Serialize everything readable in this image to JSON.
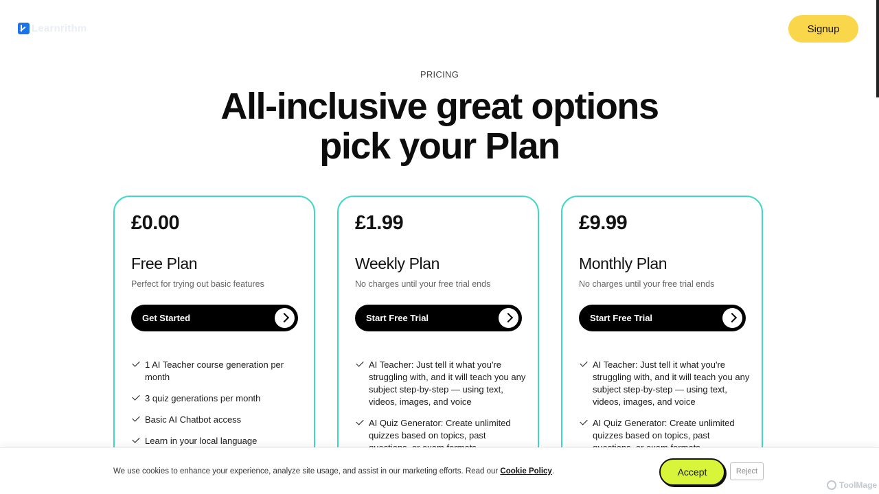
{
  "header": {
    "logo_text": "Learnrithm",
    "signup_label": "Signup"
  },
  "hero": {
    "eyebrow": "PRICING",
    "title_line1": "All-inclusive great options",
    "title_line2": "pick your Plan"
  },
  "plans": [
    {
      "price": "£0.00",
      "name": "Free Plan",
      "description": "Perfect for trying out basic features",
      "cta": "Get Started",
      "features": [
        "1 AI Teacher course generation per month",
        "3 quiz generations per month",
        "Basic AI Chatbot access",
        "Learn in your local language"
      ]
    },
    {
      "price": "£1.99",
      "name": "Weekly Plan",
      "description": "No charges until your free trial ends",
      "cta": "Start Free Trial",
      "features": [
        "AI Teacher: Just tell it what you're struggling with, and it will teach you any subject step-by-step — using text, videos, images, and voice",
        "AI Quiz Generator: Create unlimited quizzes based on topics, past questions, or exam formats"
      ]
    },
    {
      "price": "£9.99",
      "name": "Monthly Plan",
      "description": "No charges until your free trial ends",
      "cta": "Start Free Trial",
      "features": [
        "AI Teacher: Just tell it what you're struggling with, and it will teach you any subject step-by-step — using text, videos, images, and voice",
        "AI Quiz Generator: Create unlimited quizzes based on topics, past questions, or exam formats"
      ]
    }
  ],
  "cookie": {
    "text": "We use cookies to enhance your experience, analyze site usage, and assist in our marketing efforts. Read our",
    "link": "Cookie Policy",
    "period": ".",
    "accept": "Accept",
    "reject": "Reject"
  },
  "watermark": "ToolMage",
  "colors": {
    "accent_yellow": "#f9d64a",
    "accept_green": "#d8f53a",
    "card_border": "#3fd8c7",
    "logo_blue": "#1a73e8"
  }
}
